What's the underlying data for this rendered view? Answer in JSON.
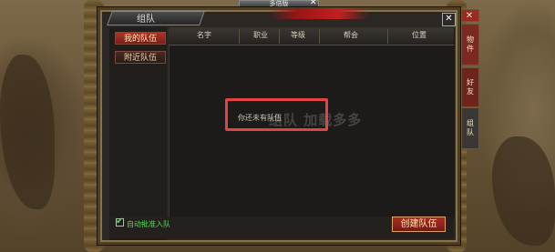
{
  "top_bar": {
    "title": "多倍版",
    "close": "✕"
  },
  "window": {
    "title": "组队",
    "close": "✕"
  },
  "left_tabs": [
    {
      "label": "我的队伍",
      "active": true
    },
    {
      "label": "附近队伍",
      "active": false
    }
  ],
  "table": {
    "columns": [
      "名字",
      "职业",
      "等级",
      "帮会",
      "位置"
    ]
  },
  "empty_message": "你还未有队伍",
  "watermark": "组队 加载多多",
  "auto_accept": {
    "label": "自动批准入队",
    "checked": true,
    "mark": "✔"
  },
  "create_button": {
    "label": "创建队伍"
  },
  "side_tabs": [
    {
      "label": "✕"
    },
    {
      "label": "物件"
    },
    {
      "label": "好友"
    },
    {
      "label": "组队"
    }
  ],
  "colors": {
    "accent_red": "#b03228",
    "highlight_box": "#e2453f",
    "checkbox_green": "#59d85a"
  }
}
